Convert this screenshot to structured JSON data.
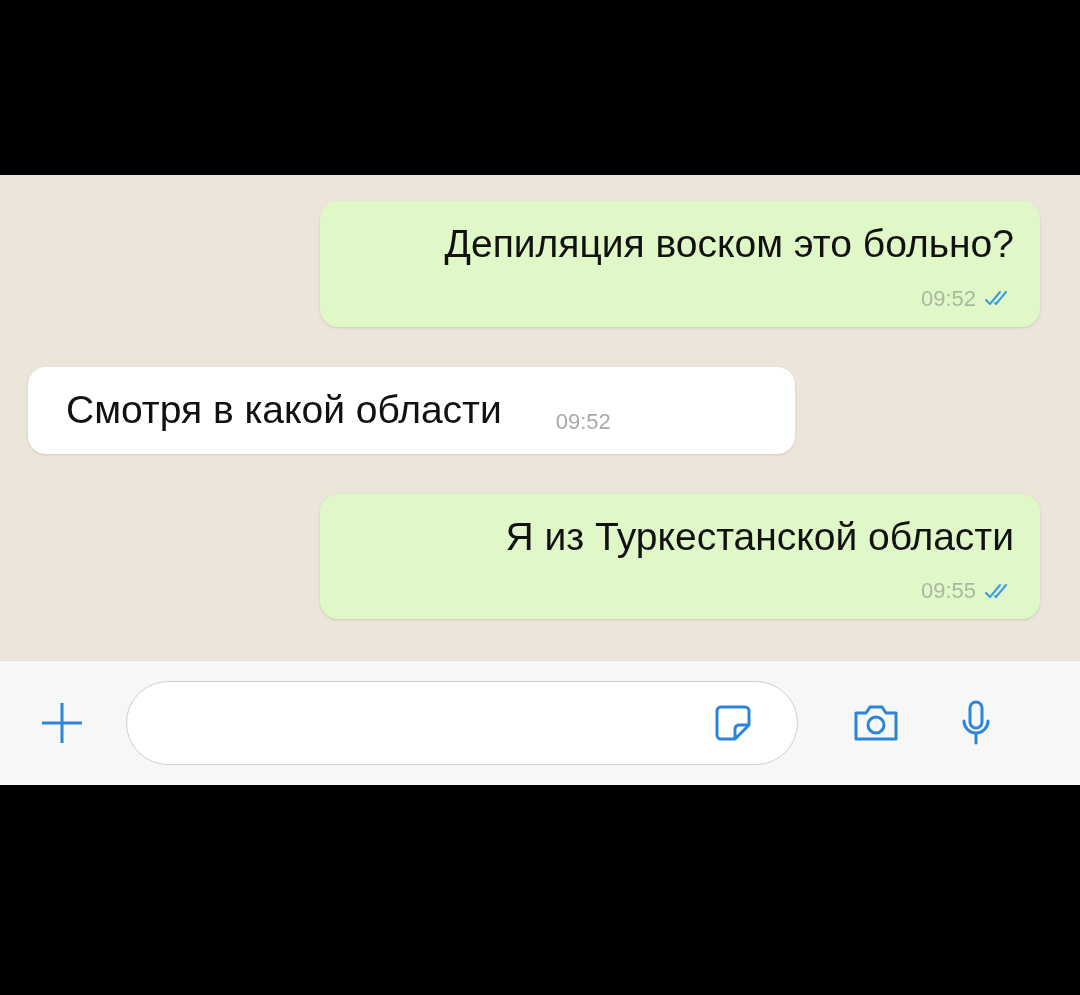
{
  "messages": [
    {
      "kind": "outgoing",
      "text": "Депиляция воском это больно?",
      "time": "09:52",
      "read": true
    },
    {
      "kind": "incoming",
      "text": "Смотря в какой области",
      "time": "09:52"
    },
    {
      "kind": "outgoing",
      "text": "Я из Туркестанской области",
      "time": "09:55",
      "read": true
    }
  ]
}
